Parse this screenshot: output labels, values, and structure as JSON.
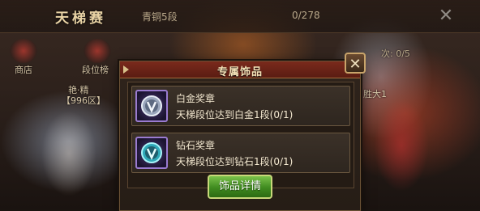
{
  "background": {
    "title": "天梯赛",
    "rank_text": "青铜5段",
    "progress_text": "0/278",
    "left_menu": [
      {
        "label": "商店"
      },
      {
        "label": "段位榜"
      }
    ],
    "left_player": {
      "name": "艳·精",
      "server": "【996区】"
    },
    "right_text": "次: 0/5",
    "right_player_text": "胜大1"
  },
  "modal": {
    "title": "专属饰品",
    "items": [
      {
        "name": "白金奖章",
        "description": "天梯段位达到白金1段(0/1)",
        "icon": "platinum-medal-icon",
        "accent": "#b9c4d8"
      },
      {
        "name": "钻石奖章",
        "description": "天梯段位达到钻石1段(0/1)",
        "icon": "diamond-medal-icon",
        "accent": "#6fe0e6"
      }
    ],
    "details_button_label": "饰品详情"
  }
}
